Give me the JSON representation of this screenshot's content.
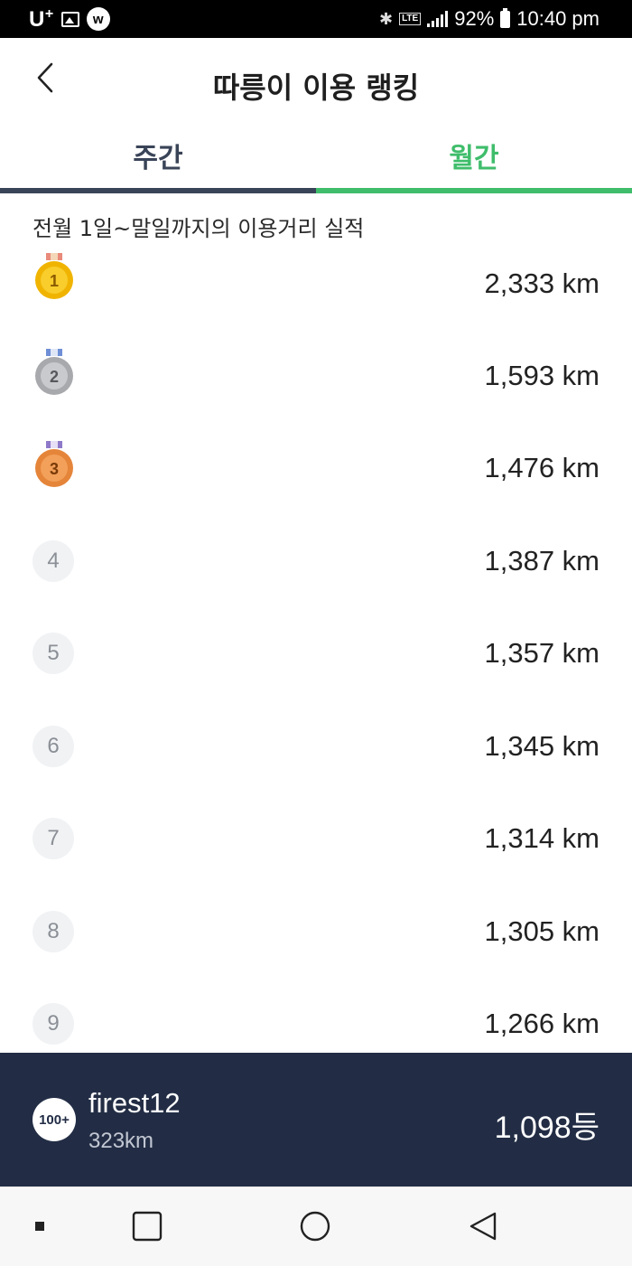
{
  "status_bar": {
    "carrier": "U",
    "carrier_plus": "+",
    "app_badge": "w",
    "network": "LTE",
    "battery": "92%",
    "time": "10:40 pm"
  },
  "header": {
    "title": "따릉이 이용 랭킹"
  },
  "tabs": [
    {
      "label": "주간",
      "active": false
    },
    {
      "label": "월간",
      "active": true
    }
  ],
  "subtitle": "전월 1일~말일까지의 이용거리 실적",
  "rankings": [
    {
      "rank": "1",
      "distance": "2,333 km",
      "medal": "gold"
    },
    {
      "rank": "2",
      "distance": "1,593 km",
      "medal": "silver"
    },
    {
      "rank": "3",
      "distance": "1,476 km",
      "medal": "bronze"
    },
    {
      "rank": "4",
      "distance": "1,387 km"
    },
    {
      "rank": "5",
      "distance": "1,357 km"
    },
    {
      "rank": "6",
      "distance": "1,345 km"
    },
    {
      "rank": "7",
      "distance": "1,314 km"
    },
    {
      "rank": "8",
      "distance": "1,305 km"
    },
    {
      "rank": "9",
      "distance": "1,266 km"
    }
  ],
  "my_rank": {
    "badge": "100+",
    "username": "firest12",
    "distance": "323km",
    "position": "1,098등"
  },
  "colors": {
    "accent_green": "#3fbd6b",
    "navy": "#222d45",
    "tab_inactive": "#3a4458"
  }
}
